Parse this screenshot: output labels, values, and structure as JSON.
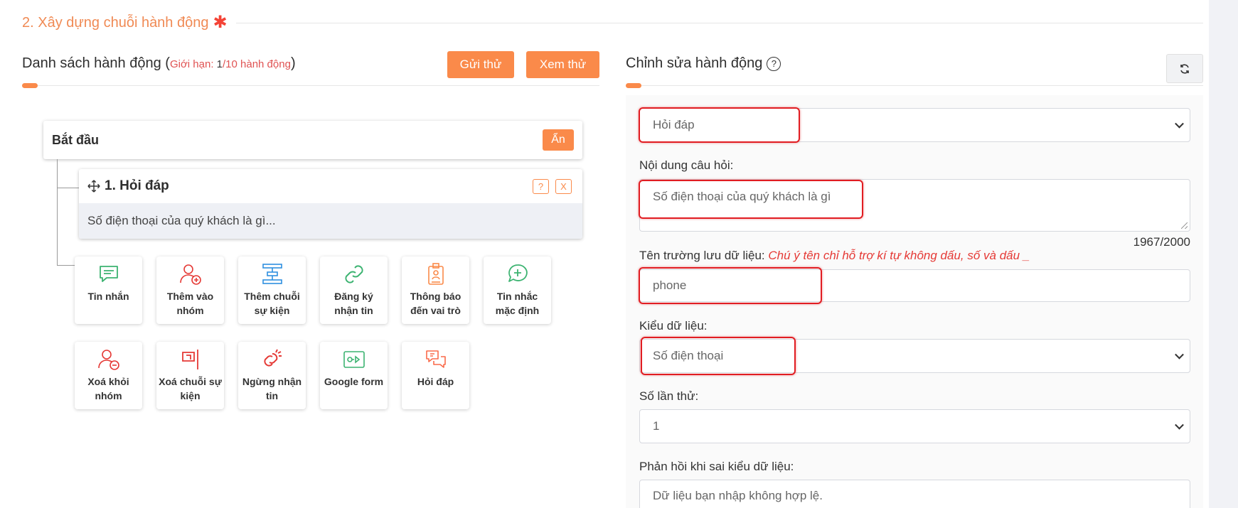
{
  "section": {
    "title": "2. Xây dựng chuỗi hành động",
    "required_mark": "✱"
  },
  "left": {
    "title": "Danh sách hành động",
    "limit_prefix": "Giới hạn: ",
    "limit_used": "1",
    "limit_suffix": "/10 hành động",
    "send_label": "Gửi thử",
    "preview_label": "Xem thử",
    "start": {
      "label": "Bắt đầu",
      "hide_label": "Ẩn"
    },
    "step": {
      "title": "1. Hỏi đáp",
      "help_label": "?",
      "close_label": "X",
      "preview": "Số điện thoại của quý khách là gì..."
    },
    "tiles": [
      {
        "label": "Tin nhắn",
        "icon": "chat-icon"
      },
      {
        "label": "Thêm vào nhóm",
        "icon": "user-add-icon"
      },
      {
        "label": "Thêm chuỗi sự kiện",
        "icon": "flow-icon"
      },
      {
        "label": "Đăng ký nhận tin",
        "icon": "link-icon"
      },
      {
        "label": "Thông báo đến vai trò",
        "icon": "badge-icon"
      },
      {
        "label": "Tin nhắc mặc định",
        "icon": "chat-plus-icon"
      },
      {
        "label": "Xoá khỏi nhóm",
        "icon": "user-remove-icon"
      },
      {
        "label": "Xoá chuỗi sự kiện",
        "icon": "flag-remove-icon"
      },
      {
        "label": "Ngừng nhận tin",
        "icon": "unlink-icon"
      },
      {
        "label": "Google form",
        "icon": "form-icon"
      },
      {
        "label": "Hỏi đáp",
        "icon": "qa-icon"
      }
    ]
  },
  "right": {
    "title": "Chỉnh sửa hành động",
    "help_label": "?",
    "action_type": "Hỏi đáp",
    "question_label": "Nội dung câu hỏi:",
    "question_value": "Số điện thoại của quý khách là gì",
    "counter": "1967/2000",
    "field_label": "Tên trường lưu dữ liệu: ",
    "field_warning": "Chú ý tên chỉ hỗ trợ kí tự không dấu, số và dấu _",
    "field_value": "phone",
    "dtype_label": "Kiểu dữ liệu:",
    "dtype_value": "Số điện thoại",
    "tries_label": "Số lần thử:",
    "tries_value": "1",
    "wrong_label": "Phản hồi khi sai kiểu dữ liệu:",
    "wrong_value": "Dữ liệu bạn nhập không hợp lệ."
  },
  "colors": {
    "accent": "#fa8a4a",
    "highlight": "#e11d22",
    "section": "#f08a54"
  }
}
